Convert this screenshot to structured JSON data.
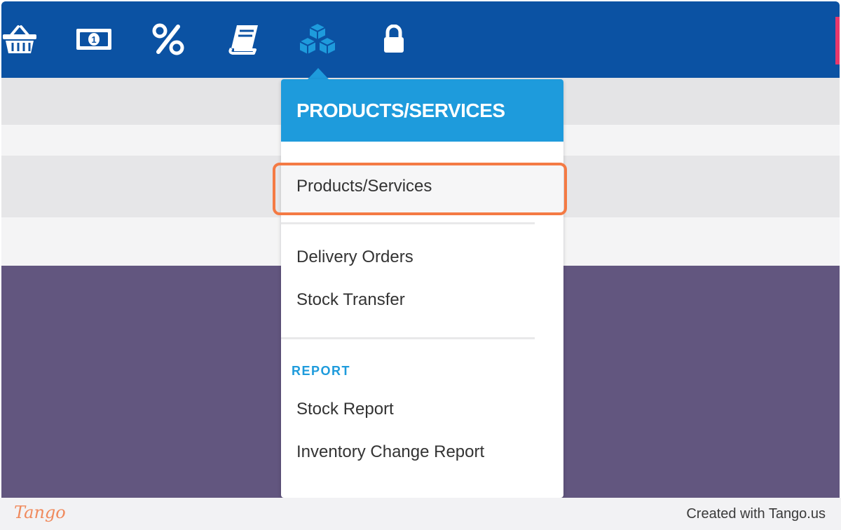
{
  "nav": {
    "icons": [
      "basket-icon",
      "banknote-icon",
      "percent-icon",
      "book-icon",
      "boxes-icon",
      "lock-icon"
    ],
    "active_icon": "boxes-icon"
  },
  "colors": {
    "nav_bg": "#0b52a3",
    "menu_header_bg": "#1e9bdc",
    "section_label": "#1e9bdc",
    "highlight_border": "#f47a44",
    "background_purple": "#62567f"
  },
  "menu": {
    "title": "PRODUCTS/SERVICES",
    "items": [
      {
        "label": "Products/Services",
        "highlighted": true
      },
      {
        "label": "Delivery Orders"
      },
      {
        "label": "Stock Transfer"
      }
    ],
    "report_section": {
      "label": "REPORT",
      "items": [
        {
          "label": "Stock Report"
        },
        {
          "label": "Inventory Change Report"
        }
      ]
    }
  },
  "footer": {
    "logo": "Tango",
    "credit": "Created with Tango.us"
  }
}
